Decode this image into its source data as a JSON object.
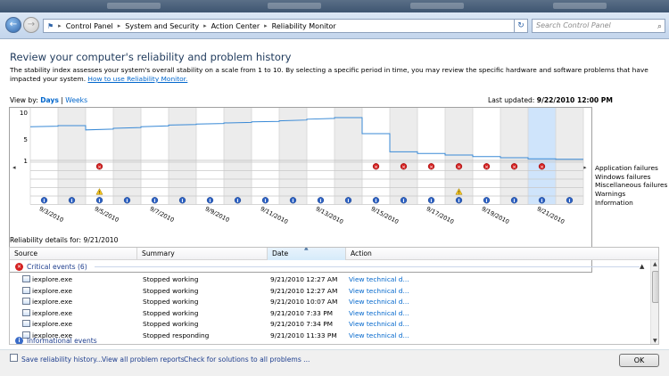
{
  "window": {
    "breadcrumb": [
      "Control Panel",
      "System and Security",
      "Action Center",
      "Reliability Monitor"
    ],
    "search_placeholder": "Search Control Panel"
  },
  "page": {
    "title": "Review your computer's reliability and problem history",
    "description": "The stability index assesses your system's overall stability on a scale from 1 to 10. By selecting a specific period in time, you may review the specific hardware and software problems that have impacted your system.",
    "help_link": "How to use Reliability Monitor."
  },
  "view": {
    "label": "View by:",
    "days": "Days",
    "weeks": "Weeks",
    "last_updated_label": "Last updated:",
    "last_updated_value": "9/22/2010 12:00 PM"
  },
  "chart_data": {
    "type": "line",
    "title": "",
    "ylim": [
      1,
      10
    ],
    "y_ticks": [
      "10",
      "5",
      "1"
    ],
    "x_dates": [
      "9/3/2010",
      "9/4/2010",
      "9/5/2010",
      "9/6/2010",
      "9/7/2010",
      "9/8/2010",
      "9/9/2010",
      "9/10/2010",
      "9/11/2010",
      "9/12/2010",
      "9/13/2010",
      "9/14/2010",
      "9/15/2010",
      "9/16/2010",
      "9/17/2010",
      "9/18/2010",
      "9/19/2010",
      "9/20/2010",
      "9/21/2010",
      "9/22/2010"
    ],
    "x_tick_labels": [
      "9/3/2010",
      "9/5/2010",
      "9/7/2010",
      "9/9/2010",
      "9/11/2010",
      "9/13/2010",
      "9/15/2010",
      "9/17/2010",
      "9/19/2010",
      "9/21/2010"
    ],
    "stability_index": [
      7.3,
      7.5,
      6.7,
      7.0,
      7.3,
      7.6,
      7.8,
      8.0,
      8.2,
      8.4,
      8.7,
      9.0,
      6.0,
      2.6,
      2.3,
      2.0,
      1.7,
      1.5,
      1.3,
      1.2
    ],
    "selected_date": "9/21/2010",
    "rows": [
      "Application failures",
      "Windows failures",
      "Miscellaneous failures",
      "Warnings",
      "Information"
    ],
    "application_failures": [
      "9/5/2010",
      "9/15/2010",
      "9/16/2010",
      "9/17/2010",
      "9/18/2010",
      "9/19/2010",
      "9/20/2010",
      "9/21/2010"
    ],
    "warnings": [
      "9/5/2010",
      "9/18/2010"
    ],
    "information": [
      "9/3/2010",
      "9/4/2010",
      "9/5/2010",
      "9/6/2010",
      "9/7/2010",
      "9/8/2010",
      "9/9/2010",
      "9/10/2010",
      "9/11/2010",
      "9/12/2010",
      "9/13/2010",
      "9/14/2010",
      "9/15/2010",
      "9/16/2010",
      "9/17/2010",
      "9/18/2010",
      "9/19/2010",
      "9/20/2010",
      "9/21/2010",
      "9/22/2010"
    ]
  },
  "details": {
    "label": "Reliability details for: 9/21/2010",
    "columns": [
      "Source",
      "Summary",
      "Date",
      "Action"
    ],
    "critical_group": "Critical events (6)",
    "rows": [
      {
        "source": "iexplore.exe",
        "summary": "Stopped working",
        "date": "9/21/2010 12:27 AM",
        "action": "View  technical d..."
      },
      {
        "source": "iexplore.exe",
        "summary": "Stopped working",
        "date": "9/21/2010 12:27 AM",
        "action": "View  technical d..."
      },
      {
        "source": "iexplore.exe",
        "summary": "Stopped working",
        "date": "9/21/2010 10:07 AM",
        "action": "View  technical d..."
      },
      {
        "source": "iexplore.exe",
        "summary": "Stopped working",
        "date": "9/21/2010 7:33 PM",
        "action": "View  technical d..."
      },
      {
        "source": "iexplore.exe",
        "summary": "Stopped working",
        "date": "9/21/2010 7:34 PM",
        "action": "View  technical d..."
      },
      {
        "source": "iexplore.exe",
        "summary": "Stopped responding",
        "date": "9/21/2010 11:33 PM",
        "action": "View  technical d..."
      }
    ],
    "info_group": "Informational events"
  },
  "footer": {
    "save": "Save reliability history...",
    "view_all": "View all problem reports",
    "check": "Check for solutions to all problems ...",
    "ok": "OK"
  }
}
